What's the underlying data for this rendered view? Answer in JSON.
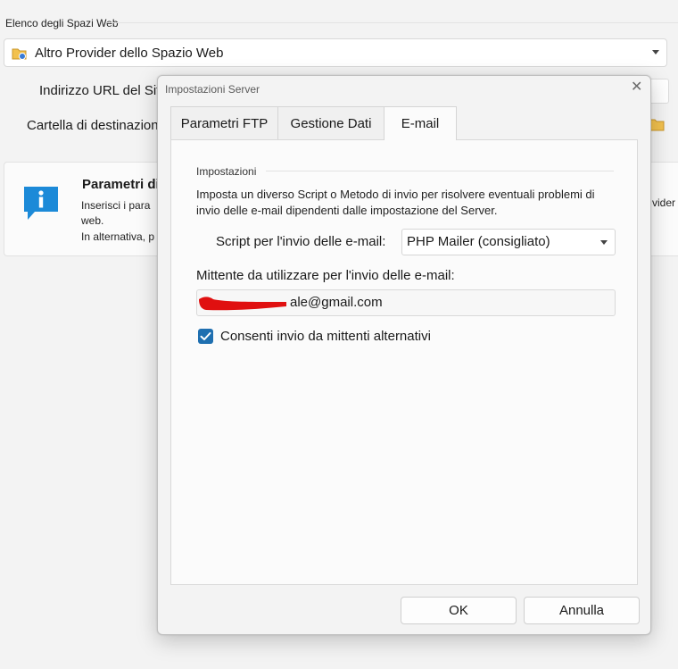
{
  "background": {
    "section_title": "Elenco degli Spazi Web",
    "provider_select": {
      "value": "Altro Provider dello Spazio Web"
    },
    "url_label": "Indirizzo URL del Sit",
    "folder_label": "Cartella di destinazione",
    "info": {
      "title": "Parametri di",
      "line1": "Inserisci i para",
      "line2": "web.",
      "line3": "In alternativa, p",
      "right_fragment": "vider"
    }
  },
  "dialog": {
    "title": "Impostazioni Server",
    "tabs": [
      {
        "label": "Parametri FTP",
        "active": false
      },
      {
        "label": "Gestione Dati",
        "active": false
      },
      {
        "label": "E-mail",
        "active": true
      }
    ],
    "email": {
      "group_label": "Impostazioni",
      "description_line1": "Imposta un diverso Script o Metodo di invio per risolvere eventuali problemi di",
      "description_line2": "invio delle e-mail dipendenti dalle impostazione del Server.",
      "script_label": "Script per l'invio delle e-mail:",
      "script_value": "PHP Mailer (consigliato)",
      "sender_label": "Mittente da utilizzare per l'invio delle e-mail:",
      "sender_value": "ale@gmail.com",
      "allow_alt_label": "Consenti invio da mittenti alternativi",
      "allow_alt_checked": true
    },
    "ok_label": "OK",
    "cancel_label": "Annulla"
  },
  "colors": {
    "accent": "#1f6fb0",
    "info_icon": "#1c8ad8",
    "redaction": "#e01010"
  }
}
